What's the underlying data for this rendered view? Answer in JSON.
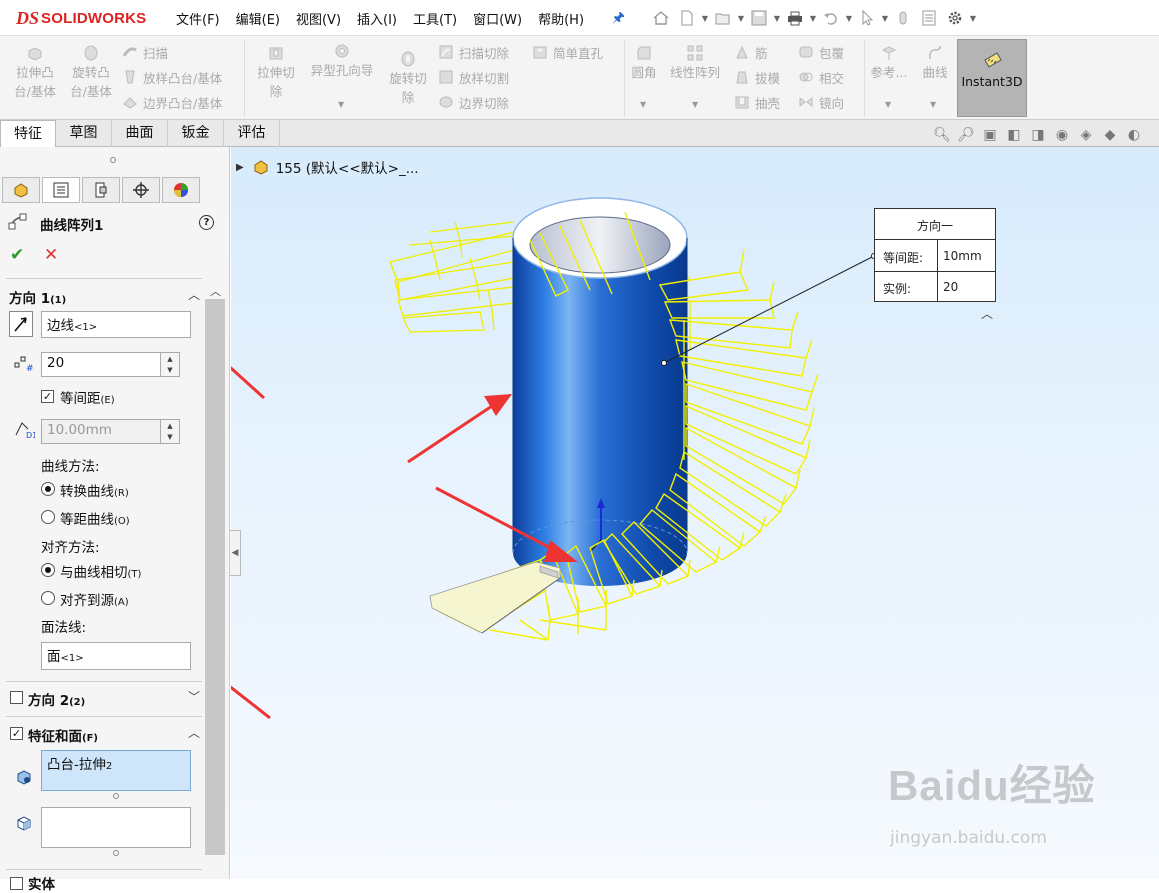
{
  "app": {
    "logo_ds": "DS",
    "logo_text": "SOLIDWORKS"
  },
  "menu": [
    "文件(F)",
    "编辑(E)",
    "视图(V)",
    "插入(I)",
    "工具(T)",
    "窗口(W)",
    "帮助(H)"
  ],
  "quick_access_icons": [
    "pin-icon",
    "home-icon",
    "new-icon",
    "open-icon",
    "save-icon",
    "print-icon",
    "undo-icon",
    "select-icon",
    "rebuild-icon",
    "options-icon",
    "gear-icon"
  ],
  "ribbon": {
    "extrude_boss": "拉伸凸\n台/基体",
    "revolve_boss": "旋转凸\n台/基体",
    "sweep": "扫描",
    "loft_boss": "放样凸台/基体",
    "boundary_boss": "边界凸台/基体",
    "extrude_cut": "拉伸切\n除",
    "hole_wizard": "异型孔向导",
    "revolve_cut": "旋转切\n除",
    "swept_cut": "扫描切除",
    "lofted_cut": "放样切割",
    "boundary_cut": "边界切除",
    "simple_hole": "简单直孔",
    "fillet": "圆角",
    "linear_pattern": "线性阵列",
    "rib": "筋",
    "draft": "拔模",
    "shell": "抽壳",
    "wrap": "包覆",
    "intersect": "相交",
    "mirror": "镜向",
    "reference": "参考...",
    "curves": "曲线",
    "instant3d": "Instant3D"
  },
  "tabs": [
    "特征",
    "草图",
    "曲面",
    "钣金",
    "评估"
  ],
  "active_tab": "特征",
  "property_manager": {
    "title": "曲线阵列1",
    "direction1": {
      "header": "方向 1",
      "header_sub": "(1)",
      "edge_value": "边线",
      "edge_sub": "<1>",
      "instances": "20",
      "equal_spacing_checked": true,
      "equal_spacing_label": "等间距",
      "equal_spacing_sub": "(E)",
      "spacing": "10.00mm",
      "curve_method_label": "曲线方法:",
      "transform_curve": "转换曲线",
      "transform_curve_sub": "(R)",
      "offset_curve": "等距曲线",
      "offset_curve_sub": "(O)",
      "curve_method_selected": "transform",
      "align_method_label": "对齐方法:",
      "tangent_to_curve": "与曲线相切",
      "tangent_to_curve_sub": "(T)",
      "align_to_seed": "对齐到源",
      "align_to_seed_sub": "(A)",
      "align_method_selected": "tangent",
      "face_normal_label": "面法线:",
      "face_normal_value": "面",
      "face_normal_sub": "<1>"
    },
    "direction2": {
      "header": "方向 2",
      "header_sub": "(2)",
      "checked": false
    },
    "features_faces": {
      "header": "特征和面",
      "header_sub": "(F)",
      "checked": true,
      "features_value": "凸台-拉伸",
      "features_sub": "2",
      "faces_value": ""
    },
    "bottom_section": "实体"
  },
  "feature_tree": {
    "part_label": "155 (默认<<默认>_..."
  },
  "callout": {
    "title": "方向一",
    "spacing_label": "等间距:",
    "spacing_value": "10mm",
    "instances_label": "实例:",
    "instances_value": "20"
  },
  "watermark": {
    "brand": "Baidu经验",
    "url": "jingyan.baidu.com"
  },
  "colors": {
    "accent_red": "#d22222",
    "cylinder_blue": "#1b5fc8",
    "preview_yellow": "#f2f200",
    "selection_blue": "#cfe5fa",
    "arrow_red": "#ee3333"
  }
}
